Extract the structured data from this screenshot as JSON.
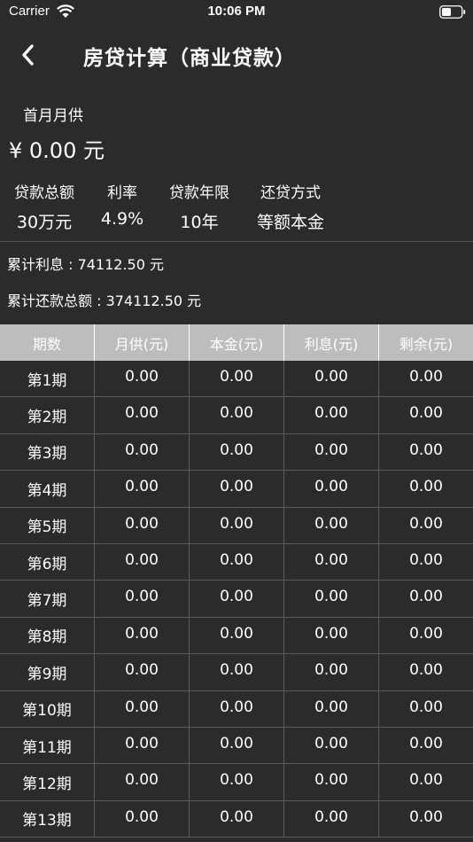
{
  "status_bar": {
    "carrier": "Carrier",
    "time": "10:06 PM"
  },
  "nav": {
    "title": "房贷计算（商业贷款）"
  },
  "summary": {
    "first_month_label": "首月月供",
    "first_month_value": "¥ 0.00 元",
    "params": [
      {
        "label": "贷款总额",
        "value": "30万元"
      },
      {
        "label": "利率",
        "value": "4.9%"
      },
      {
        "label": "贷款年限",
        "value": "10年"
      },
      {
        "label": "还贷方式",
        "value": "等额本金"
      }
    ]
  },
  "totals": {
    "interest": "累计利息 : 74112.50 元",
    "total_repayment": "累计还款总额 : 374112.50 元"
  },
  "table": {
    "headers": [
      "期数",
      "月供(元)",
      "本金(元)",
      "利息(元)",
      "剩余(元)"
    ],
    "rows": [
      [
        "第1期",
        "0.00",
        "0.00",
        "0.00",
        "0.00"
      ],
      [
        "第2期",
        "0.00",
        "0.00",
        "0.00",
        "0.00"
      ],
      [
        "第3期",
        "0.00",
        "0.00",
        "0.00",
        "0.00"
      ],
      [
        "第4期",
        "0.00",
        "0.00",
        "0.00",
        "0.00"
      ],
      [
        "第5期",
        "0.00",
        "0.00",
        "0.00",
        "0.00"
      ],
      [
        "第6期",
        "0.00",
        "0.00",
        "0.00",
        "0.00"
      ],
      [
        "第7期",
        "0.00",
        "0.00",
        "0.00",
        "0.00"
      ],
      [
        "第8期",
        "0.00",
        "0.00",
        "0.00",
        "0.00"
      ],
      [
        "第9期",
        "0.00",
        "0.00",
        "0.00",
        "0.00"
      ],
      [
        "第10期",
        "0.00",
        "0.00",
        "0.00",
        "0.00"
      ],
      [
        "第11期",
        "0.00",
        "0.00",
        "0.00",
        "0.00"
      ],
      [
        "第12期",
        "0.00",
        "0.00",
        "0.00",
        "0.00"
      ],
      [
        "第13期",
        "0.00",
        "0.00",
        "0.00",
        "0.00"
      ]
    ]
  },
  "colors": {
    "background": "#2b2b2b",
    "header_bg": "#bdbdbd",
    "text": "#ffffff"
  }
}
